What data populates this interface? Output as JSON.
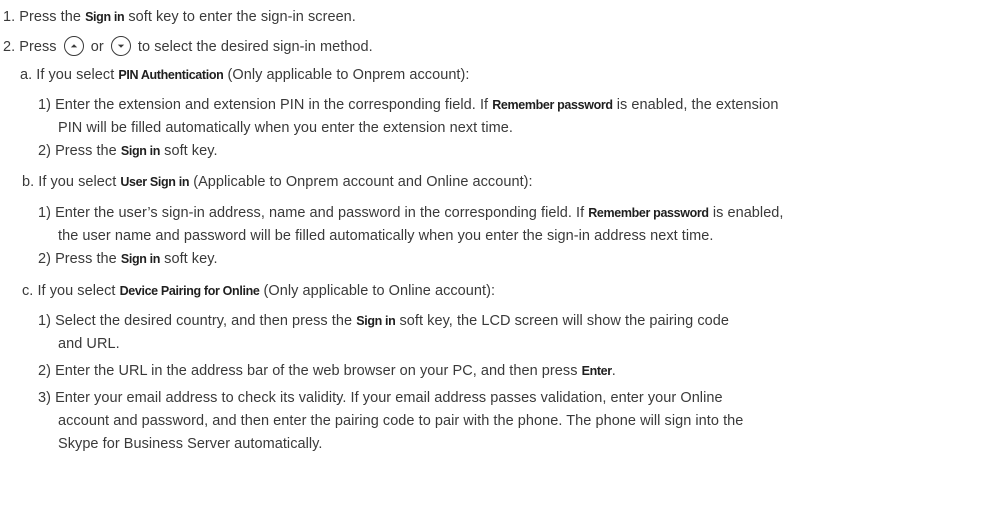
{
  "steps": [
    {
      "num": "1.",
      "pre": " Press the ",
      "bold": "Sign in",
      "post": " soft key to enter the sign-in screen."
    },
    {
      "num": "2.",
      "pre": " Press ",
      "mid": " or ",
      "post": " to select the desired sign-in method."
    }
  ],
  "a": {
    "heading": {
      "pre": "a. If you select ",
      "bold": "PIN Authentication",
      "post": " (Only applicable to Onprem account):"
    },
    "s1": {
      "pre": "1) Enter the extension and extension PIN in the corresponding field. If ",
      "bold": "Remember password",
      "post": " is enabled, the extension"
    },
    "s1_cont": "PIN will be filled automatically when you enter the extension next time.",
    "s2": {
      "pre": "2) Press the ",
      "bold": "Sign in",
      "post": " soft key."
    }
  },
  "b": {
    "heading": {
      "pre": "b. If you select ",
      "bold": "User Sign in",
      "post": " (Applicable to Onprem account and Online account):"
    },
    "s1": {
      "pre": "1) Enter the user’s sign-in address, name and password in the corresponding field. If ",
      "bold": "Remember password",
      "post": " is enabled,"
    },
    "s1_cont": "the user name and password will be filled automatically when you enter the sign-in address next time.",
    "s2": {
      "pre": "2) Press the ",
      "bold": "Sign in",
      "post": " soft key."
    }
  },
  "c": {
    "heading": {
      "pre": "c. If you select ",
      "bold": "Device Pairing for Online",
      "post": " (Only applicable to Online account):"
    },
    "s1": {
      "pre": "1) Select the desired country, and then press the ",
      "bold": "Sign in",
      "post": " soft key, the LCD screen will show the pairing code"
    },
    "s1_cont": "and URL.",
    "s2": {
      "pre": "2) Enter the URL in the address bar of the web browser on your PC, and then press ",
      "bold": "Enter",
      "post": "."
    },
    "s3": "3) Enter your email address to check its validity. If your email address passes validation, enter your Online",
    "s3_cont1": "account and password, and then enter the pairing code to pair with the phone. The phone will sign into the",
    "s3_cont2": "Skype for Business Server automatically."
  },
  "icons": {
    "up": "up-arrow-key-icon",
    "down": "down-arrow-key-icon"
  }
}
